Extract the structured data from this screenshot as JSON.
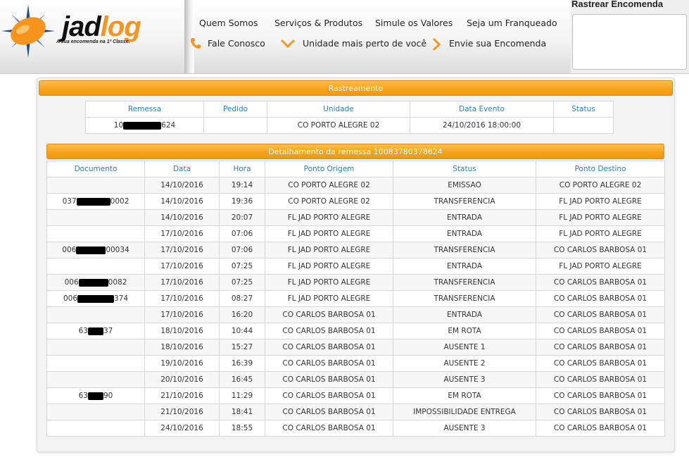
{
  "header": {
    "logo_text": "jadlog",
    "tagline": "A sua encomenda na 1ª Classe.",
    "nav_top": [
      "Quem Somos",
      "Serviços & Produtos",
      "Simule os Valores",
      "Seja um Franqueado"
    ],
    "nav_bottom": [
      "Fale Conosco",
      "Unidade mais perto de você",
      "Envie sua Encomenda"
    ],
    "track_title": "Rastrear Encomenda",
    "track_value": ""
  },
  "colors": {
    "accent_orange": "#f7a21c",
    "header_blue": "#2a7fb3"
  },
  "rastreamento": {
    "title": "Rastreamento",
    "columns": [
      "Remessa",
      "Pedido",
      "Unidade",
      "Data Evento",
      "Status"
    ],
    "row": {
      "remessa_prefix": "10",
      "remessa_suffix": "624",
      "pedido": "",
      "unidade": "CO PORTO ALEGRE 02",
      "data_evento": "24/10/2016 18:00:00",
      "status": ""
    }
  },
  "detalhamento": {
    "title": "Detalhamento da remessa 10083780378624",
    "columns": [
      "Documento",
      "Data",
      "Hora",
      "Ponto Origem",
      "Status",
      "Ponto Destino"
    ],
    "rows": [
      {
        "doc_a": "",
        "doc_b": "",
        "data": "14/10/2016",
        "hora": "19:14",
        "origem": "CO PORTO ALEGRE 02",
        "status": "EMISSAO",
        "destino": "CO PORTO ALEGRE 02"
      },
      {
        "doc_a": "037",
        "doc_b": "0002",
        "data": "14/10/2016",
        "hora": "19:36",
        "origem": "CO PORTO ALEGRE 02",
        "status": "TRANSFERENCIA",
        "destino": "FL JAD PORTO ALEGRE"
      },
      {
        "doc_a": "",
        "doc_b": "",
        "data": "14/10/2016",
        "hora": "20:07",
        "origem": "FL JAD PORTO ALEGRE",
        "status": "ENTRADA",
        "destino": "FL JAD PORTO ALEGRE"
      },
      {
        "doc_a": "",
        "doc_b": "",
        "data": "17/10/2016",
        "hora": "07:06",
        "origem": "FL JAD PORTO ALEGRE",
        "status": "ENTRADA",
        "destino": "FL JAD PORTO ALEGRE"
      },
      {
        "doc_a": "006",
        "doc_b": "00034",
        "data": "17/10/2016",
        "hora": "07:06",
        "origem": "FL JAD PORTO ALEGRE",
        "status": "TRANSFERENCIA",
        "destino": "CO CARLOS BARBOSA 01"
      },
      {
        "doc_a": "",
        "doc_b": "",
        "data": "17/10/2016",
        "hora": "07:25",
        "origem": "FL JAD PORTO ALEGRE",
        "status": "ENTRADA",
        "destino": "FL JAD PORTO ALEGRE"
      },
      {
        "doc_a": "006",
        "doc_b": "0082",
        "data": "17/10/2016",
        "hora": "07:25",
        "origem": "FL JAD PORTO ALEGRE",
        "status": "TRANSFERENCIA",
        "destino": "CO CARLOS BARBOSA 01"
      },
      {
        "doc_a": "006",
        "doc_b": "374",
        "data": "17/10/2016",
        "hora": "08:27",
        "origem": "FL JAD PORTO ALEGRE",
        "status": "TRANSFERENCIA",
        "destino": "CO CARLOS BARBOSA 01"
      },
      {
        "doc_a": "",
        "doc_b": "",
        "data": "17/10/2016",
        "hora": "16:20",
        "origem": "CO CARLOS BARBOSA 01",
        "status": "ENTRADA",
        "destino": "CO CARLOS BARBOSA 01"
      },
      {
        "doc_a": "63",
        "doc_b": "37",
        "data": "18/10/2016",
        "hora": "10:44",
        "origem": "CO CARLOS BARBOSA 01",
        "status": "EM ROTA",
        "destino": "CO CARLOS BARBOSA 01"
      },
      {
        "doc_a": "",
        "doc_b": "",
        "data": "18/10/2016",
        "hora": "15:27",
        "origem": "CO CARLOS BARBOSA 01",
        "status": "AUSENTE 1",
        "destino": "CO CARLOS BARBOSA 01"
      },
      {
        "doc_a": "",
        "doc_b": "",
        "data": "19/10/2016",
        "hora": "16:39",
        "origem": "CO CARLOS BARBOSA 01",
        "status": "AUSENTE 2",
        "destino": "CO CARLOS BARBOSA 01"
      },
      {
        "doc_a": "",
        "doc_b": "",
        "data": "20/10/2016",
        "hora": "16:45",
        "origem": "CO CARLOS BARBOSA 01",
        "status": "AUSENTE 3",
        "destino": "CO CARLOS BARBOSA 01"
      },
      {
        "doc_a": "63",
        "doc_b": "90",
        "data": "21/10/2016",
        "hora": "11:29",
        "origem": "CO CARLOS BARBOSA 01",
        "status": "EM ROTA",
        "destino": "CO CARLOS BARBOSA 01"
      },
      {
        "doc_a": "",
        "doc_b": "",
        "data": "21/10/2016",
        "hora": "18:41",
        "origem": "CO CARLOS BARBOSA 01",
        "status": "IMPOSSIBILIDADE ENTREGA",
        "destino": "CO CARLOS BARBOSA 01"
      },
      {
        "doc_a": "",
        "doc_b": "",
        "data": "24/10/2016",
        "hora": "18:55",
        "origem": "CO CARLOS BARBOSA 01",
        "status": "AUSENTE 3",
        "destino": "CO CARLOS BARBOSA 01"
      }
    ]
  }
}
